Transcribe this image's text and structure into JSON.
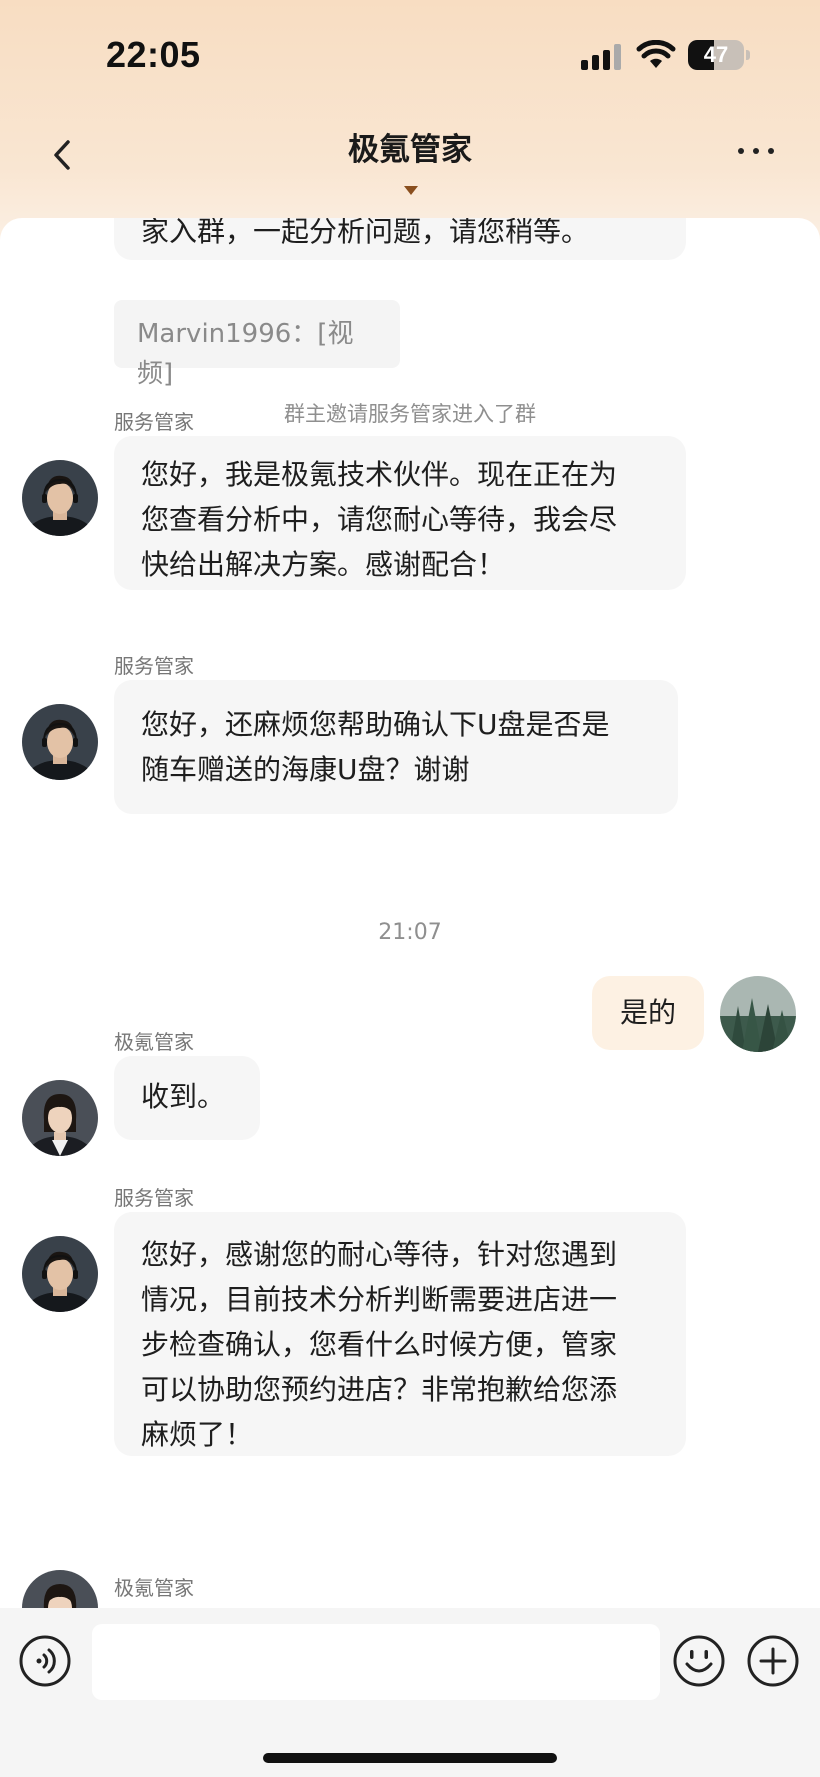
{
  "status_bar": {
    "time": "22:05",
    "battery_level": "47",
    "battery_fraction": 0.47,
    "signal_icon": "cellular-signal-icon",
    "wifi_icon": "wifi-icon",
    "battery_icon": "battery-icon"
  },
  "nav": {
    "title": "极氪管家",
    "back_icon": "chevron-left-icon",
    "more_icon": "more-dots-icon",
    "title_caret_icon": "caret-down-icon"
  },
  "messages": {
    "partial_top": "家入群，一起分析问题，请您稍等。",
    "video_msg": "Marvin1996：[视频]",
    "system_notice": "群主邀请服务管家进入了群",
    "msg1": {
      "sender": "服务管家",
      "lines": [
        "您好，我是极氪技术伙伴。现在正在为",
        "您查看分析中，请您耐心等待，我会尽",
        "快给出解决方案。感谢配合！"
      ]
    },
    "msg2": {
      "sender": "服务管家",
      "lines": [
        "您好，还麻烦您帮助确认下U盘是否是",
        "随车赠送的海康U盘？谢谢"
      ]
    },
    "timestamp": "21:07",
    "msg3": {
      "text": "是的"
    },
    "msg4": {
      "sender": "极氪管家",
      "text": "收到。"
    },
    "msg5": {
      "sender": "服务管家",
      "lines": [
        "您好，感谢您的耐心等待，针对您遇到",
        "情况，目前技术分析判断需要进店进一",
        "步检查确认，您看什么时候方便，管家",
        "可以协助您预约进店？非常抱歉给您添",
        "麻烦了！"
      ]
    },
    "msg6": {
      "sender": "极氪管家"
    }
  },
  "input_bar": {
    "voice_icon": "voice-input-icon",
    "emoji_icon": "emoji-icon",
    "plus_icon": "plus-icon",
    "input_value": "",
    "input_placeholder": ""
  },
  "colors": {
    "header_bg": "#f8ddc2",
    "accent_caret": "#8a4f1e",
    "incoming_bubble": "#f6f6f6",
    "outgoing_bubble": "#fdf1e3"
  }
}
